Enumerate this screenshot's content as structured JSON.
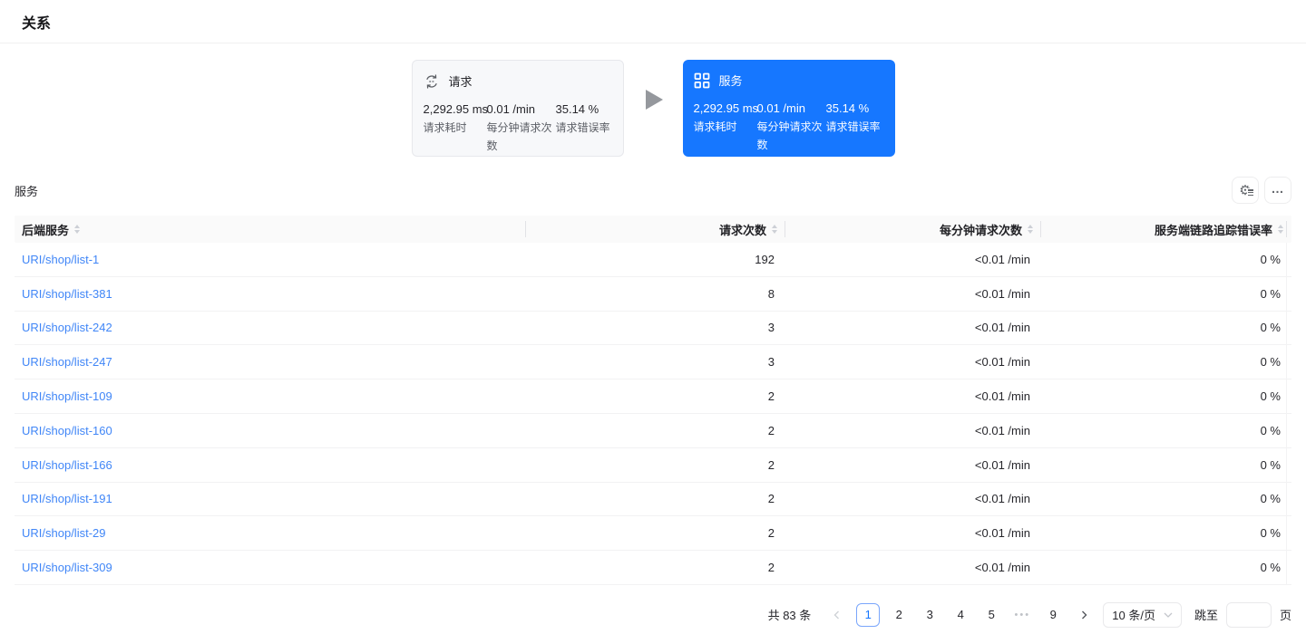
{
  "page": {
    "title": "关系"
  },
  "diagram": {
    "request_card": {
      "title": "请求",
      "icon": "sync-icon",
      "metrics": [
        {
          "value": "2,292.95 ms",
          "label": "请求耗时"
        },
        {
          "value": "0.01 /min",
          "label": "每分钟请求次数"
        },
        {
          "value": "35.14 %",
          "label": "请求错误率"
        }
      ]
    },
    "service_card": {
      "title": "服务",
      "icon": "grid-icon",
      "metrics": [
        {
          "value": "2,292.95 ms",
          "label": "请求耗时"
        },
        {
          "value": "0.01 /min",
          "label": "每分钟请求次数"
        },
        {
          "value": "35.14 %",
          "label": "请求错误率"
        }
      ]
    }
  },
  "section": {
    "title": "服务",
    "tools": [
      "settings-icon",
      "more-icon"
    ]
  },
  "table": {
    "columns": [
      {
        "label": "后端服务",
        "sortable": true
      },
      {
        "label": "请求次数",
        "sortable": true
      },
      {
        "label": "每分钟请求次数",
        "sortable": true
      },
      {
        "label": "服务端链路追踪错误率",
        "sortable": true
      }
    ],
    "rows": [
      {
        "service": "URI/shop/list-1",
        "requests": "192",
        "per_min": "<0.01 /min",
        "error_rate": "0 %"
      },
      {
        "service": "URI/shop/list-381",
        "requests": "8",
        "per_min": "<0.01 /min",
        "error_rate": "0 %"
      },
      {
        "service": "URI/shop/list-242",
        "requests": "3",
        "per_min": "<0.01 /min",
        "error_rate": "0 %"
      },
      {
        "service": "URI/shop/list-247",
        "requests": "3",
        "per_min": "<0.01 /min",
        "error_rate": "0 %"
      },
      {
        "service": "URI/shop/list-109",
        "requests": "2",
        "per_min": "<0.01 /min",
        "error_rate": "0 %"
      },
      {
        "service": "URI/shop/list-160",
        "requests": "2",
        "per_min": "<0.01 /min",
        "error_rate": "0 %"
      },
      {
        "service": "URI/shop/list-166",
        "requests": "2",
        "per_min": "<0.01 /min",
        "error_rate": "0 %"
      },
      {
        "service": "URI/shop/list-191",
        "requests": "2",
        "per_min": "<0.01 /min",
        "error_rate": "0 %"
      },
      {
        "service": "URI/shop/list-29",
        "requests": "2",
        "per_min": "<0.01 /min",
        "error_rate": "0 %"
      },
      {
        "service": "URI/shop/list-309",
        "requests": "2",
        "per_min": "<0.01 /min",
        "error_rate": "0 %"
      }
    ]
  },
  "pagination": {
    "total": "共 83 条",
    "pages": [
      "1",
      "2",
      "3",
      "4",
      "5",
      "•••",
      "9"
    ],
    "current": "1",
    "page_size": "10 条/页",
    "jump_label": "跳至",
    "page_suffix": "页",
    "jump_value": ""
  },
  "colors": {
    "accent": "#1677ff",
    "link": "#4086f7",
    "card_bg": "#f7f8fa",
    "header_bg": "#fafafa"
  }
}
